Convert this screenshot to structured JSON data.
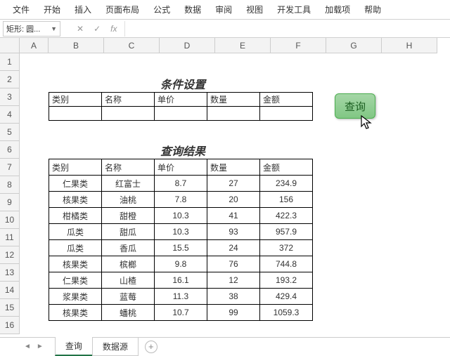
{
  "menu": [
    "文件",
    "开始",
    "插入",
    "页面布局",
    "公式",
    "数据",
    "审阅",
    "视图",
    "开发工具",
    "加载项",
    "帮助"
  ],
  "namebox": "矩形: 圆...",
  "columns": [
    "A",
    "B",
    "C",
    "D",
    "E",
    "F",
    "G",
    "H"
  ],
  "rows": [
    "1",
    "2",
    "3",
    "4",
    "5",
    "6",
    "7",
    "8",
    "9",
    "10",
    "11",
    "12",
    "13",
    "14",
    "15",
    "16"
  ],
  "titles": {
    "condition": "条件设置",
    "result": "查询结果"
  },
  "headers": [
    "类别",
    "名称",
    "单价",
    "数量",
    "金额"
  ],
  "query_btn": "查询",
  "results": [
    [
      "仁果类",
      "红富士",
      "8.7",
      "27",
      "234.9"
    ],
    [
      "核果类",
      "油桃",
      "7.8",
      "20",
      "156"
    ],
    [
      "柑橘类",
      "甜橙",
      "10.3",
      "41",
      "422.3"
    ],
    [
      "瓜类",
      "甜瓜",
      "10.3",
      "93",
      "957.9"
    ],
    [
      "瓜类",
      "香瓜",
      "15.5",
      "24",
      "372"
    ],
    [
      "核果类",
      "槟榔",
      "9.8",
      "76",
      "744.8"
    ],
    [
      "仁果类",
      "山楂",
      "16.1",
      "12",
      "193.2"
    ],
    [
      "浆果类",
      "蓝莓",
      "11.3",
      "38",
      "429.4"
    ],
    [
      "核果类",
      "蟠桃",
      "10.7",
      "99",
      "1059.3"
    ]
  ],
  "sheets": {
    "active": "查询",
    "other": "数据源"
  }
}
